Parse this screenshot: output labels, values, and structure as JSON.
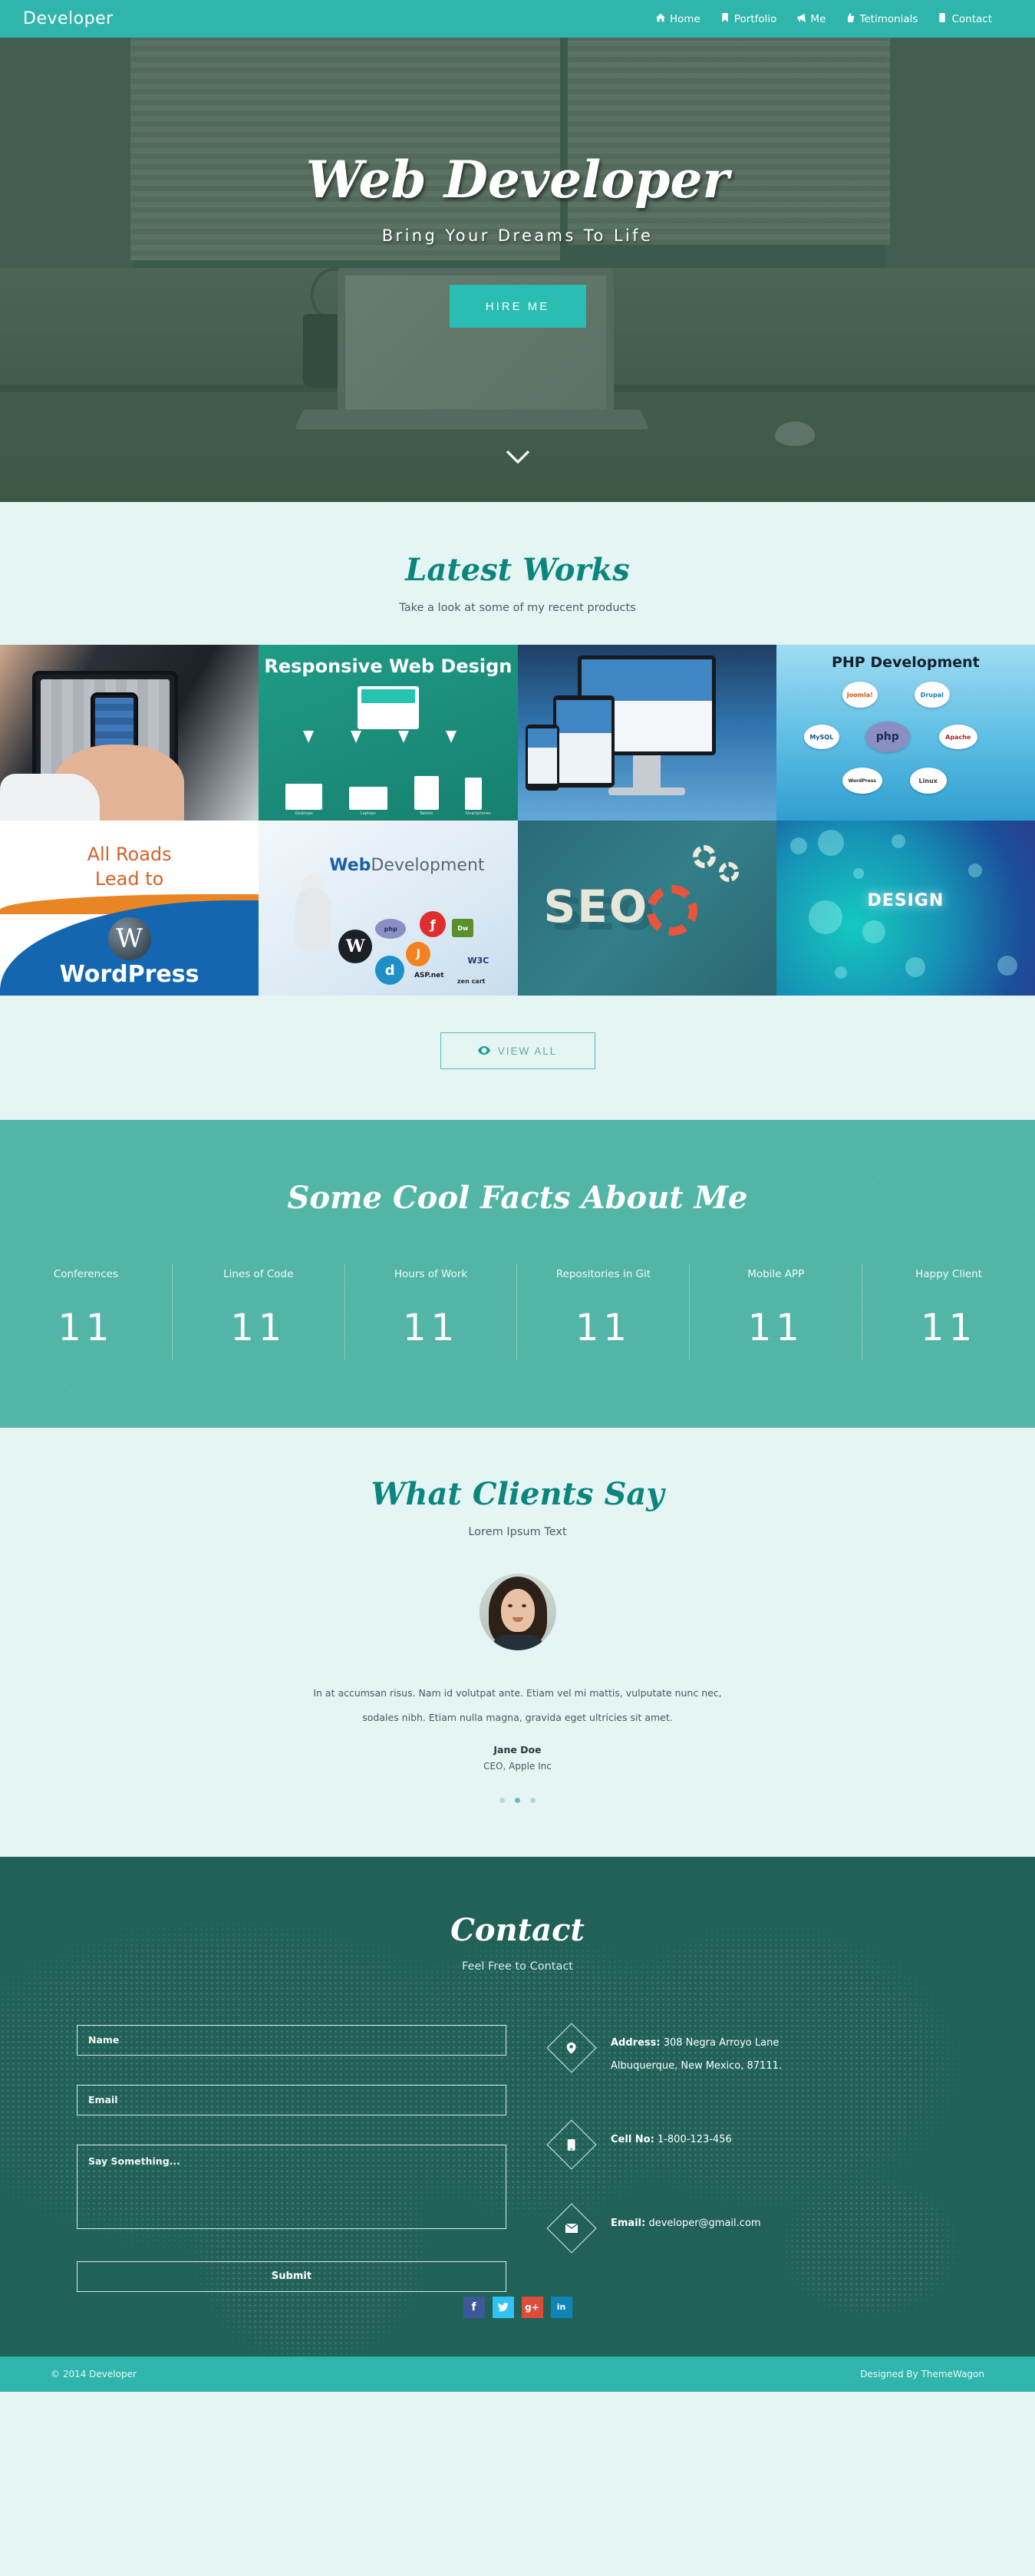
{
  "nav": {
    "brand": "Developer",
    "links": [
      {
        "label": "Home",
        "icon": "home-icon"
      },
      {
        "label": "Portfolio",
        "icon": "bookmark-icon"
      },
      {
        "label": "Me",
        "icon": "megaphone-icon"
      },
      {
        "label": "Tetimonials",
        "icon": "thumbs-up-icon"
      },
      {
        "label": "Contact",
        "icon": "phone-icon"
      }
    ]
  },
  "hero": {
    "title": "Web Developer",
    "subtitle": "Bring Your Dreams To Life",
    "cta": "HIRE ME",
    "scroll_icon": "chevron-down-icon"
  },
  "works": {
    "title": "Latest Works",
    "subtitle": "Take a look at some of my recent products",
    "view_all": "VIEW ALL",
    "view_all_icon": "eye-icon",
    "items": [
      {
        "name": "tablet-and-phone-photo",
        "caption": ""
      },
      {
        "name": "responsive-web-design",
        "caption": "Responsive Web Design",
        "devices": [
          "Desktops",
          "Laptops",
          "Tablets",
          "Smartphones"
        ]
      },
      {
        "name": "multi-device-mockup",
        "caption": ""
      },
      {
        "name": "php-development",
        "caption": "PHP Development",
        "logos": [
          "Joomla!",
          "Drupal",
          "MySQL",
          "php",
          "Apache",
          "WordPress",
          "Linux"
        ]
      },
      {
        "name": "wordpress-banner",
        "line1": "All Roads",
        "line2": "Lead to",
        "line3": "WordPress"
      },
      {
        "name": "web-development",
        "caption_bold": "Web",
        "caption_light": "Development",
        "logos": [
          "php",
          "W",
          "Joomla",
          "Flash",
          "Dw",
          "ASP.net",
          "W3C",
          ".NET",
          "zen cart"
        ]
      },
      {
        "name": "seo-gears",
        "caption": "SEO"
      },
      {
        "name": "design-bokeh",
        "caption": "DESIGN"
      }
    ]
  },
  "facts": {
    "title": "Some Cool Facts About Me",
    "counters": [
      {
        "label": "Conferences",
        "value": "11"
      },
      {
        "label": "Lines of Code",
        "value": "11"
      },
      {
        "label": "Hours of Work",
        "value": "11"
      },
      {
        "label": "Repositories in Git",
        "value": "11"
      },
      {
        "label": "Mobile APP",
        "value": "11"
      },
      {
        "label": "Happy Client",
        "value": "11"
      }
    ]
  },
  "testimonials": {
    "title": "What Clients Say",
    "subtitle": "Lorem Ipsum Text",
    "quote": "In at accumsan risus. Nam id volutpat ante. Etiam vel mi mattis, vulputate nunc nec, sodales nibh. Etiam nulla magna, gravida eget ultricies sit amet.",
    "author": "Jane Doe",
    "role": "CEO, Apple Inc",
    "dots": 3,
    "active_dot": 1
  },
  "contact": {
    "title": "Contact",
    "subtitle": "Feel Free to Contact",
    "form": {
      "name_placeholder": "Name",
      "email_placeholder": "Email",
      "message_placeholder": "Say Something...",
      "submit_label": "Submit"
    },
    "info": [
      {
        "icon": "map-pin-icon",
        "label": "Address:",
        "value": "308 Negra Arroyo Lane",
        "value2": "Albuquerque, New Mexico, 87111."
      },
      {
        "icon": "mobile-phone-icon",
        "label": "Cell No:",
        "value": "1-800-123-456"
      },
      {
        "icon": "envelope-icon",
        "label": "Email:",
        "value": "developer@gmail.com"
      }
    ],
    "socials": [
      {
        "name": "facebook",
        "glyph": "f",
        "color": "#3b5998"
      },
      {
        "name": "twitter",
        "glyph": "",
        "color": "#2fc2f5"
      },
      {
        "name": "google-plus",
        "glyph": "g+",
        "color": "#dd4b39"
      },
      {
        "name": "linkedin",
        "glyph": "in",
        "color": "#0e84b8"
      }
    ]
  },
  "footer": {
    "copyright": "© 2014 Developer",
    "credit": "Designed By ThemeWagon"
  },
  "colors": {
    "brand_teal": "#2fb5ac",
    "deep_teal": "#216158",
    "facts_teal": "#52b5a6",
    "light_bg": "#e4f5f4",
    "heading_teal": "#0c857f"
  }
}
